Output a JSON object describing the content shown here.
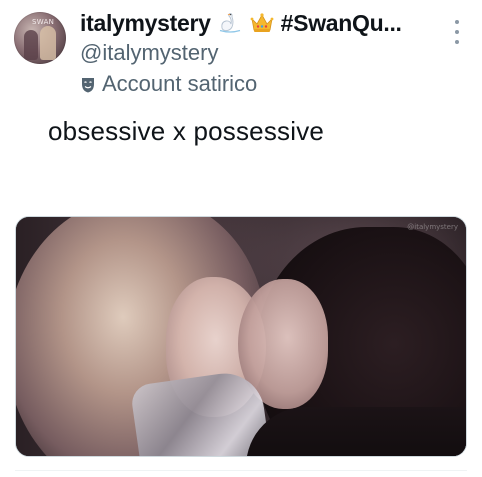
{
  "author": {
    "display_name": "italymystery",
    "name_emojis": [
      "swan-emoji",
      "crown-emoji"
    ],
    "hashtag_truncated": "#SwanQu...",
    "handle": "@italymystery",
    "account_label": "Account satirico",
    "avatar_text": "SWAN"
  },
  "tweet": {
    "text": "obsessive x possessive"
  },
  "media": {
    "type": "image",
    "description_icon": "photo",
    "watermark": "@italymystery"
  },
  "colors": {
    "text_primary": "#0f1419",
    "text_secondary": "#536471",
    "border": "#cfd9de",
    "more_dots": "#8b98a5"
  }
}
